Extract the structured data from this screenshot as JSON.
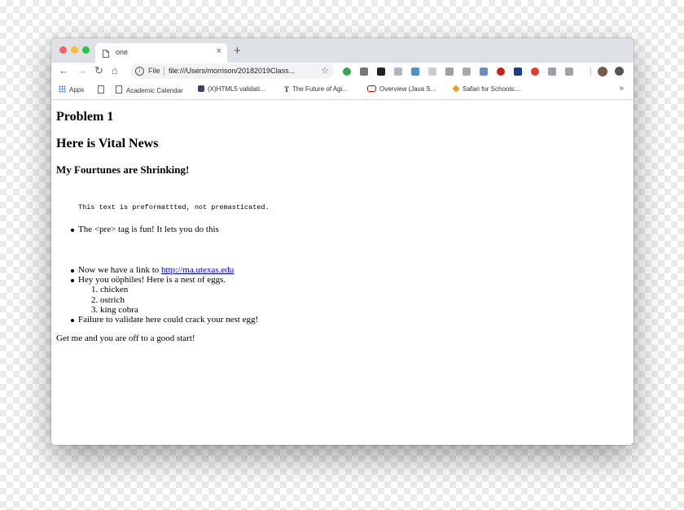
{
  "browser": {
    "tab_title": "one",
    "tab_close": "×",
    "new_tab": "+",
    "nav": {
      "back": "←",
      "forward": "→",
      "reload": "↻",
      "home": "⌂"
    },
    "omnibox": {
      "scheme": "File",
      "url": "file:///Users/morrison/20182019Class...",
      "star": "☆"
    },
    "extension_colors": [
      "#34a853",
      "#777777",
      "#222222",
      "#b0b6c0",
      "#4a90d9",
      "#cccccc",
      "#9aa0a6",
      "#aaaaaa",
      "#6a8fc8",
      "#cc1f1f",
      "#1a3d8f",
      "#e33b2e",
      "#9aa0a6",
      "#a0a0a0"
    ],
    "bookmarks": [
      {
        "label": "Apps",
        "icon": "apps-grid-icon"
      },
      {
        "label": "",
        "icon": "page-icon"
      },
      {
        "label": "Academic Calendar",
        "icon": "page-icon"
      },
      {
        "label": "(X)HTML5 validati...",
        "icon": "validator-icon"
      },
      {
        "label": "The Future of Agi...",
        "icon": "nyt-icon"
      },
      {
        "label": "Overview (Java S...",
        "icon": "oracle-icon"
      },
      {
        "label": "Safari for Schools:...",
        "icon": "safari-schools-icon"
      }
    ],
    "bookmarks_more": "»"
  },
  "page": {
    "h1": "Problem 1",
    "h2": "Here is Vital News",
    "h3": "My Fourtunes are Shrinking!",
    "list": {
      "item1": "The <pre> tag is fun! It lets you do this",
      "pre": "This text is preformattted, not premasticated.",
      "item2_prefix": "Now we have a link to ",
      "item2_link": "http://ma.utexas.edu",
      "item3": "Hey you oöphiles! Here is a nest of eggs.",
      "eggs": [
        "1. chicken",
        "2. ostrich",
        "3. king cobra"
      ],
      "item4": "Failure to validate here could crack your nest egg!"
    },
    "closing": "Get me and you are off to a good start!"
  }
}
